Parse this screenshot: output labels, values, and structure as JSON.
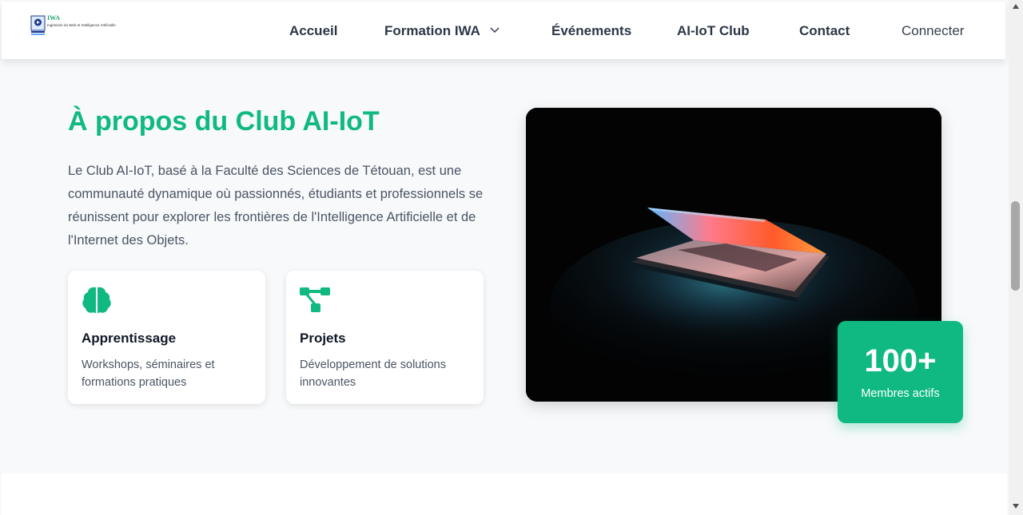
{
  "nav": {
    "logo_text": "IWA",
    "logo_subtitle": "Ingénierie du Web et Intelligence Artificielle",
    "items": [
      {
        "label": "Accueil"
      },
      {
        "label": "Formation IWA"
      },
      {
        "label": "Événements"
      },
      {
        "label": "AI-IoT Club"
      },
      {
        "label": "Contact"
      },
      {
        "label": "Connecter"
      }
    ],
    "dropdown_icon": "chevron-down-icon"
  },
  "about": {
    "title": "À propos du Club AI-IoT",
    "description": "Le Club AI-IoT, basé à la Faculté des Sciences de Tétouan, est une communauté dynamique où passionnés, étudiants et professionnels se réunissent pour explorer les frontières de l'Intelligence Artificielle et de l'Internet des Objets.",
    "cards": [
      {
        "icon": "brain-icon",
        "title": "Apprentissage",
        "text": "Workshops, séminaires et formations pratiques"
      },
      {
        "icon": "project-diagram-icon",
        "title": "Projets",
        "text": "Développement de solutions innovantes"
      }
    ],
    "image": "laptop-glow-photo",
    "stat": {
      "value": "100+",
      "label": "Membres actifs"
    }
  },
  "colors": {
    "accent": "#10b981",
    "heading": "#2d3748",
    "text": "#4b5563",
    "background": "#f7f9fb"
  }
}
